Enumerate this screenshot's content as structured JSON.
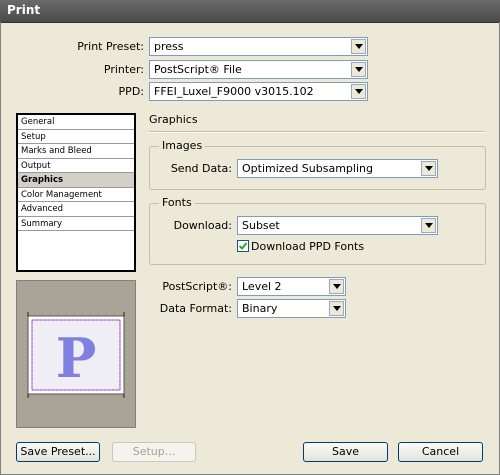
{
  "window": {
    "title": "Print"
  },
  "top_fields": {
    "preset_label": "Print Preset:",
    "preset_value": "press",
    "printer_label": "Printer:",
    "printer_value": "PostScript® File",
    "ppd_label": "PPD:",
    "ppd_value": "FFEI_Luxel_F9000 v3015.102"
  },
  "sidebar": {
    "items": [
      {
        "label": "General"
      },
      {
        "label": "Setup"
      },
      {
        "label": "Marks and Bleed"
      },
      {
        "label": "Output"
      },
      {
        "label": "Graphics",
        "selected": true
      },
      {
        "label": "Color Management"
      },
      {
        "label": "Advanced"
      },
      {
        "label": "Summary"
      }
    ]
  },
  "preview": {
    "letter": "P"
  },
  "graphics": {
    "title": "Graphics",
    "images": {
      "title": "Images",
      "send_data_label": "Send Data:",
      "send_data_value": "Optimized Subsampling"
    },
    "fonts": {
      "title": "Fonts",
      "download_label": "Download:",
      "download_value": "Subset",
      "ppd_fonts_label": "Download PPD Fonts",
      "ppd_fonts_checked": true
    },
    "postscript_label": "PostScript®:",
    "postscript_value": "Level 2",
    "data_format_label": "Data Format:",
    "data_format_value": "Binary"
  },
  "buttons": {
    "save_preset": "Save Preset...",
    "setup": "Setup...",
    "save": "Save",
    "cancel": "Cancel"
  },
  "colors": {
    "accent": "#003c74",
    "preview_letter": "#8080e0"
  }
}
